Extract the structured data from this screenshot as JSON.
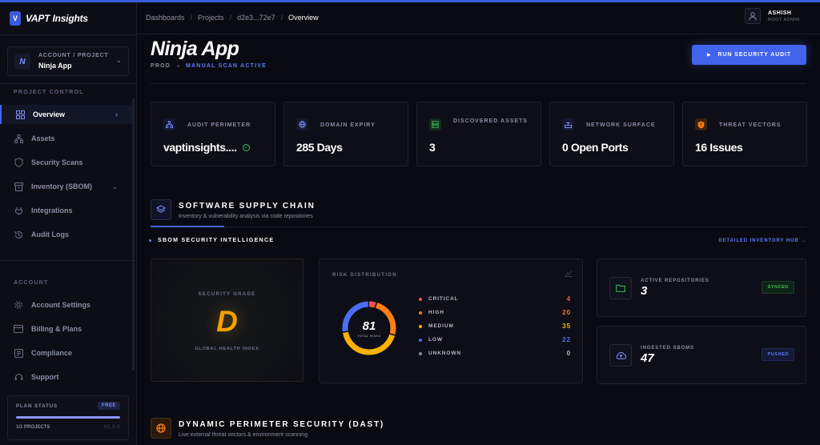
{
  "brand": {
    "logo_letter": "V",
    "name": "VAPT Insights"
  },
  "project_switcher": {
    "badge": "N",
    "caption": "ACCOUNT / PROJECT",
    "name": "Ninja App"
  },
  "sidebar": {
    "section_project": "PROJECT CONTROL",
    "section_account": "ACCOUNT",
    "items": [
      {
        "label": "Overview",
        "icon": "grid-icon",
        "active": true
      },
      {
        "label": "Assets",
        "icon": "sitemap-icon"
      },
      {
        "label": "Security Scans",
        "icon": "shield-icon"
      },
      {
        "label": "Inventory (SBOM)",
        "icon": "box-icon"
      },
      {
        "label": "Integrations",
        "icon": "plug-icon"
      },
      {
        "label": "Audit Logs",
        "icon": "history-icon"
      }
    ],
    "account_items": [
      {
        "label": "Account Settings",
        "icon": "gear-icon"
      },
      {
        "label": "Billing & Plans",
        "icon": "card-icon"
      },
      {
        "label": "Compliance",
        "icon": "document-icon"
      },
      {
        "label": "Support",
        "icon": "headset-icon"
      }
    ]
  },
  "plan": {
    "label": "PLAN STATUS",
    "badge": "FREE",
    "projects": "1/1 PROJECTS",
    "version": "V2.0.0",
    "usage": 1.0
  },
  "breadcrumbs": [
    "Dashboards",
    "Projects",
    "d2e3...72e7",
    "Overview"
  ],
  "user": {
    "name": "ASHISH",
    "role": "ROOT ADMIN"
  },
  "header": {
    "title": "Ninja App",
    "env": "PROD",
    "scan_status": "MANUAL SCAN ACTIVE",
    "run_button": "RUN SECURITY AUDIT"
  },
  "stats": [
    {
      "label": "AUDIT PERIMETER",
      "value": "vaptinsights....",
      "icon": "sitemap-icon",
      "verified": true
    },
    {
      "label": "DOMAIN EXPIRY",
      "value": "285 Days",
      "icon": "globe-icon"
    },
    {
      "label": "DISCOVERED ASSETS",
      "value": "3",
      "icon": "server-icon"
    },
    {
      "label": "NETWORK SURFACE",
      "value": "0 Open Ports",
      "icon": "network-icon"
    },
    {
      "label": "THREAT VECTORS",
      "value": "16 Issues",
      "icon": "shield-alert-icon"
    }
  ],
  "supply_chain": {
    "title": "SOFTWARE SUPPLY CHAIN",
    "subtitle": "Inventory & vulnerability analysis via code repositories",
    "intel_title": "SBOM SECURITY INTELLIGENCE",
    "intel_link": "DETAILED INVENTORY HUB →"
  },
  "grade": {
    "label": "SECURITY GRADE",
    "letter": "D",
    "sub": "GLOBAL HEALTH INDEX"
  },
  "risk": {
    "title": "RISK DISTRIBUTION",
    "total": "81",
    "total_label": "TOTAL RISKS",
    "items": [
      {
        "name": "CRITICAL",
        "value": "4",
        "color": "#fa5252"
      },
      {
        "name": "HIGH",
        "value": "20",
        "color": "#fd7e14"
      },
      {
        "name": "MEDIUM",
        "value": "35",
        "color": "#fab005"
      },
      {
        "name": "LOW",
        "value": "22",
        "color": "#4c6ef5"
      },
      {
        "name": "UNKNOWN",
        "value": "0",
        "color": "#868e96"
      }
    ]
  },
  "repos": {
    "label": "ACTIVE REPOSITORIES",
    "value": "3",
    "badge": "SYNCED"
  },
  "sboms": {
    "label": "INGESTED SBOMS",
    "value": "47",
    "badge": "PUSHED"
  },
  "dast": {
    "title": "DYNAMIC PERIMETER SECURITY (DAST)",
    "subtitle": "Live external threat vectors & environment scanning"
  },
  "colors": {
    "accent": "#4263eb",
    "grade": "#f59f00",
    "success": "#40c057"
  }
}
